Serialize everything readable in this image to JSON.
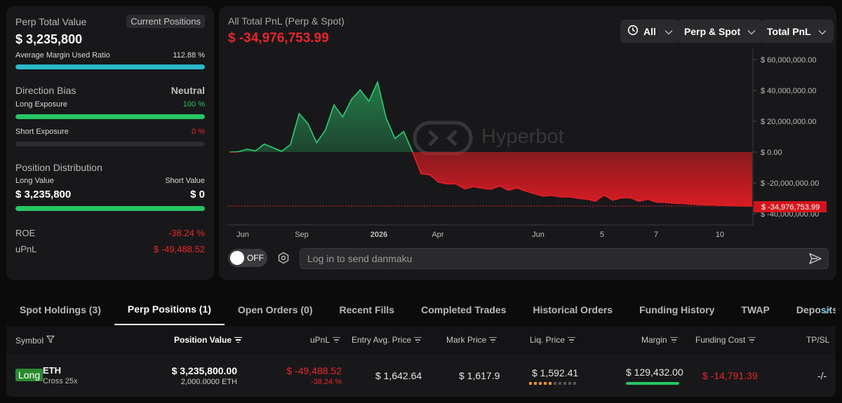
{
  "summary": {
    "perp_total_value_label": "Perp Total Value",
    "current_positions_label": "Current Positions",
    "perp_total_value": "$ 3,235,800",
    "avg_margin_label": "Average Margin Used Ratio",
    "avg_margin_value": "112.88 %",
    "avg_margin_fill": 1.0,
    "direction_bias_label": "Direction Bias",
    "direction_bias_value": "Neutral",
    "long_exposure_label": "Long Exposure",
    "long_exposure_value": "100 %",
    "long_exposure_fill": 1.0,
    "short_exposure_label": "Short Exposure",
    "short_exposure_value": "0 %",
    "short_exposure_fill": 0.0,
    "position_distribution_label": "Position Distribution",
    "long_value_label": "Long Value",
    "short_value_label": "Short Value",
    "long_value": "$ 3,235,800",
    "short_value": "$ 0",
    "distribution_fill": 1.0,
    "roe_label": "ROE",
    "roe_value": "-38.24 %",
    "upnl_label": "uPnL",
    "upnl_value": "$ -49,488.52"
  },
  "chart_header": {
    "title": "All Total PnL (Perp & Spot)",
    "value": "$ -34,976,753.99",
    "range_label": "All",
    "market_label": "Perp & Spot",
    "metric_label": "Total PnL",
    "watermark": "Hyperbot",
    "current_tag": "$ -34,976,753.99"
  },
  "chart_data": {
    "type": "area",
    "y_ticks": [
      "$ 60,000,000.00",
      "$ 40,000,000.00",
      "$ 20,000,000.00",
      "$ 0.00",
      "$ -20,000,000.00",
      "$ -40,000,000.00"
    ],
    "x_ticks": [
      "Jun",
      "Sep",
      "2026",
      "Apr",
      "Jun",
      "5",
      "7",
      "10"
    ],
    "ylim": [
      -40000000,
      60000000
    ],
    "colors": {
      "positive": "#2ecc71",
      "negative": "#e11d24"
    },
    "series": [
      {
        "values": [
          0,
          0.2,
          1.8,
          0.8,
          5.2,
          2.8,
          0.5,
          4.8,
          25,
          18.5,
          6.1,
          14.1,
          30.6,
          22.8,
          34.1,
          40.3,
          33,
          45.4,
          21.8,
          8.8,
          13.3,
          0.3,
          -14,
          -14.7,
          -19.5,
          -20.6,
          -20.6,
          -23.8,
          -22.3,
          -23.4,
          -24.1,
          -21.9,
          -24.7,
          -23.2,
          -25.3,
          -26.9,
          -28.5,
          -28.1,
          -29.1,
          -29,
          -30,
          -30.5,
          -31.9,
          -27.9,
          -31.2,
          -29.7,
          -29.6,
          -31.9,
          -30.6,
          -32.4,
          -32.6,
          -33.1,
          -33.3,
          -33.7,
          -34,
          -34.2,
          -34.4,
          -34.6,
          -34.8,
          -34.9,
          -34.976753
        ]
      }
    ]
  },
  "danmaku": {
    "toggle_label": "OFF",
    "placeholder": "Log in to send danmaku"
  },
  "tabs": [
    "Spot Holdings (3)",
    "Perp Positions (1)",
    "Open Orders (0)",
    "Recent Fills",
    "Completed Trades",
    "Historical Orders",
    "Funding History",
    "TWAP",
    "Deposits & Withdraw"
  ],
  "table": {
    "headers": {
      "symbol": "Symbol",
      "position_value": "Position Value",
      "upnl": "uPnL",
      "entry": "Entry Avg. Price",
      "mark": "Mark Price",
      "liq": "Liq. Price",
      "margin": "Margin",
      "funding": "Funding Cost",
      "tpsl": "TP/SL"
    },
    "row": {
      "side": "Long",
      "symbol": "ETH",
      "leverage": "Cross 25x",
      "position_value": "$ 3,235,800.00",
      "position_size": "2,000.0000 ETH",
      "upnl": "$ -49,488.52",
      "upnl_pct": "-38.24 %",
      "entry": "$ 1,642.64",
      "mark": "$ 1,617.9",
      "liq": "$ 1,592.41",
      "margin": "$ 129,432.00",
      "funding": "$ -14,791.39",
      "tpsl": "-/-"
    }
  },
  "colors": {
    "accent_blue": "#2bb9cc",
    "green": "#26c664",
    "red": "#e8262a"
  }
}
